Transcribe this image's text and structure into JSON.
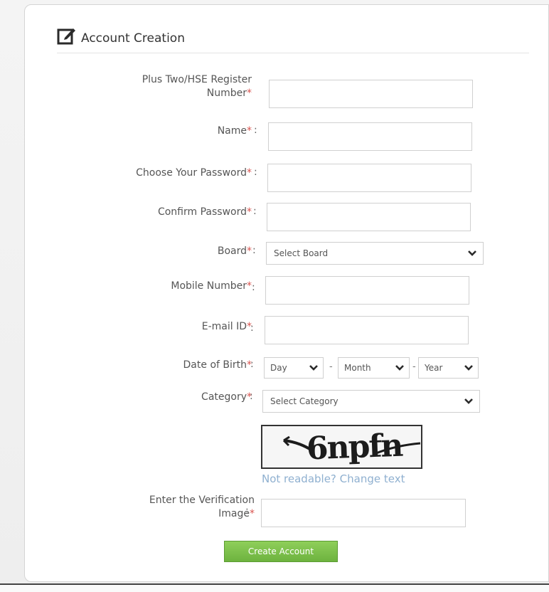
{
  "form": {
    "title": "Account Creation",
    "required_mark": "*",
    "colon": ":",
    "register_label_line1": "Plus Two/HSE Register",
    "register_label_line2": "Number",
    "name_label": "Name",
    "password_label": "Choose Your Password",
    "confirm_label": "Confirm Password",
    "board_label": "Board",
    "board_selected": "Select Board",
    "mobile_label": "Mobile Number",
    "email_label": "E-mail ID",
    "dob_label": "Date of Birth",
    "dob_day": "Day",
    "dob_month": "Month",
    "dob_year": "Year",
    "dob_separator": "-",
    "category_label": "Category",
    "category_selected": "Select Category",
    "captcha_text": "6npfn",
    "captcha_refresh": "Not readable? Change text",
    "verification_label_line1": "Enter the Verification",
    "verification_label_line2": "Image",
    "submit_label": "Create Account"
  },
  "icons": {
    "header": "edit-icon",
    "select": "chevron-down-icon"
  },
  "colors": {
    "required": "#d9534f",
    "button": "#7cc04a",
    "link": "#8fb0d0"
  }
}
